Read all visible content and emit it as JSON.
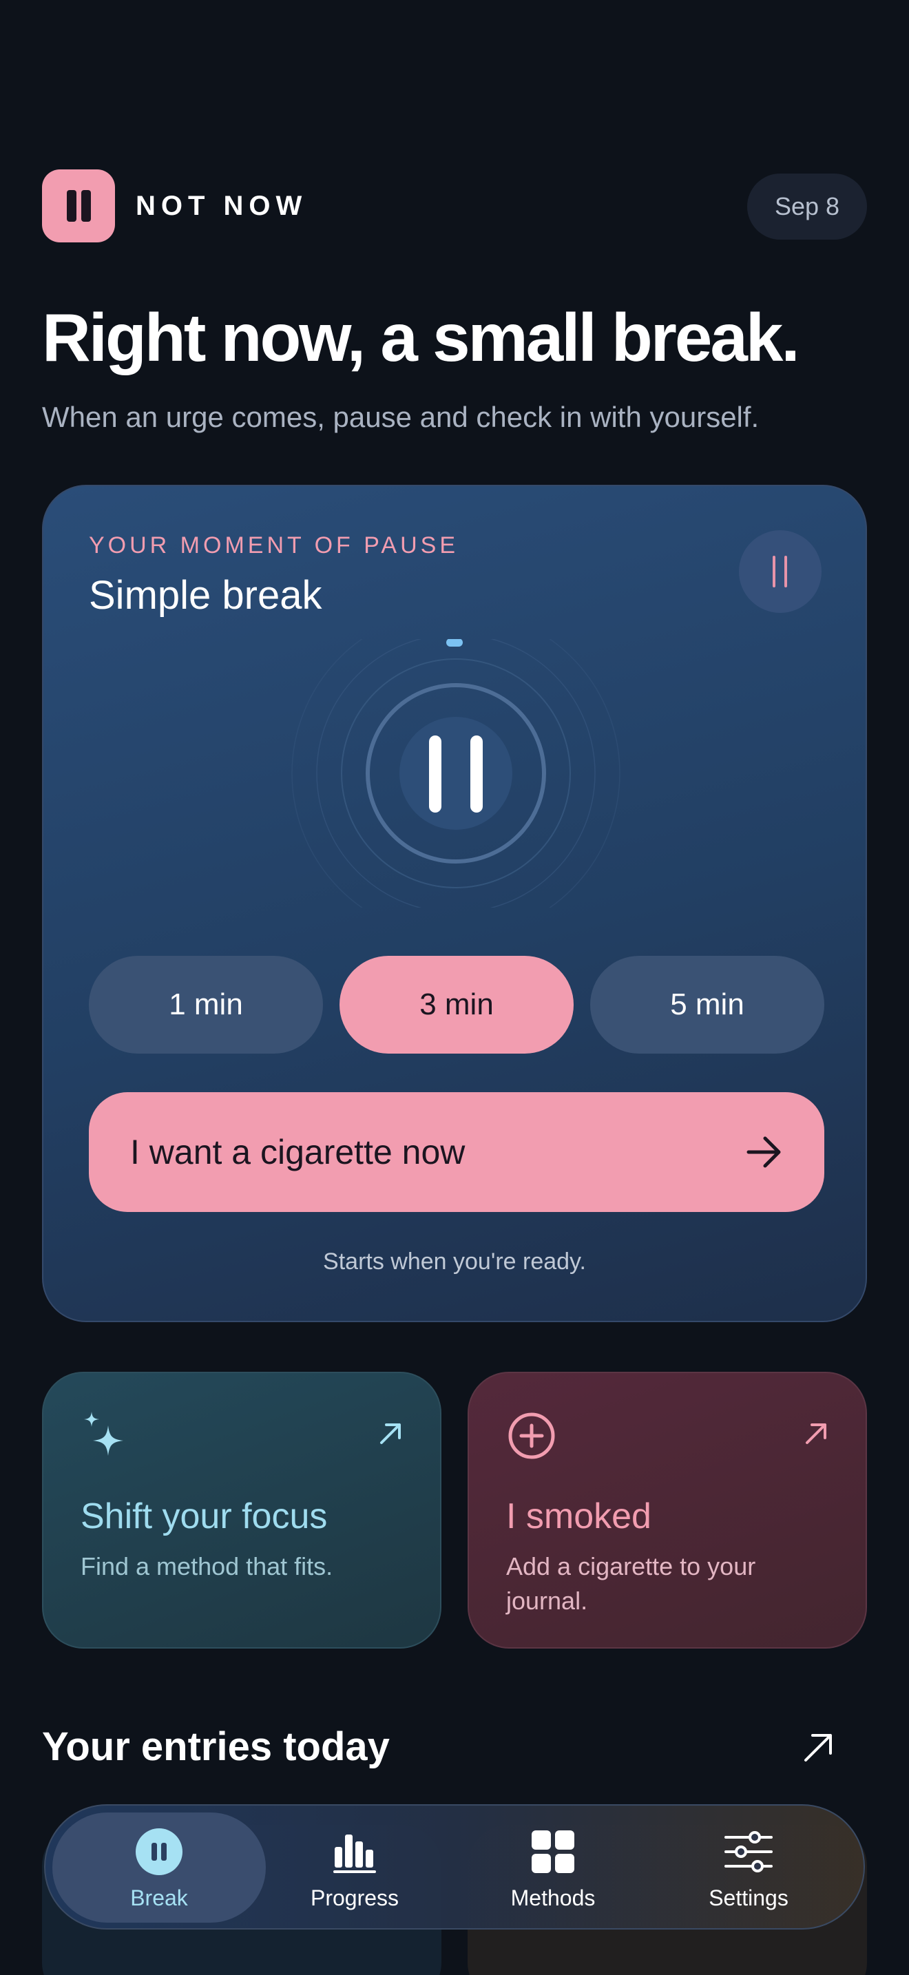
{
  "header": {
    "brand": "NOT NOW",
    "date": "Sep 8"
  },
  "hero": {
    "title": "Right now, a small break.",
    "subtitle": "When an urge comes, pause and check in with yourself."
  },
  "pause_card": {
    "kicker": "YOUR MOMENT OF PAUSE",
    "title": "Simple break",
    "durations": [
      {
        "label": "1 min",
        "selected": false
      },
      {
        "label": "3 min",
        "selected": true
      },
      {
        "label": "5 min",
        "selected": false
      }
    ],
    "cta_label": "I want a cigarette now",
    "note": "Starts when you're ready."
  },
  "tiles": {
    "focus": {
      "title": "Shift your focus",
      "description": "Find a method that fits.",
      "icon": "sparkle-icon"
    },
    "smoked": {
      "title": "I smoked",
      "description": "Add a cigarette to your journal.",
      "icon": "plus-circle-icon"
    }
  },
  "entries": {
    "title": "Your entries today"
  },
  "tabbar": {
    "active": "break",
    "items": [
      {
        "id": "break",
        "label": "Break",
        "icon": "pause-icon"
      },
      {
        "id": "progress",
        "label": "Progress",
        "icon": "bar-chart-icon"
      },
      {
        "id": "methods",
        "label": "Methods",
        "icon": "grid-icon"
      },
      {
        "id": "settings",
        "label": "Settings",
        "icon": "sliders-icon"
      }
    ]
  },
  "colors": {
    "accent_pink": "#f29db0",
    "accent_cyan": "#a6e1f3",
    "background": "#0d121a",
    "card_blue": "#2a4d78"
  }
}
